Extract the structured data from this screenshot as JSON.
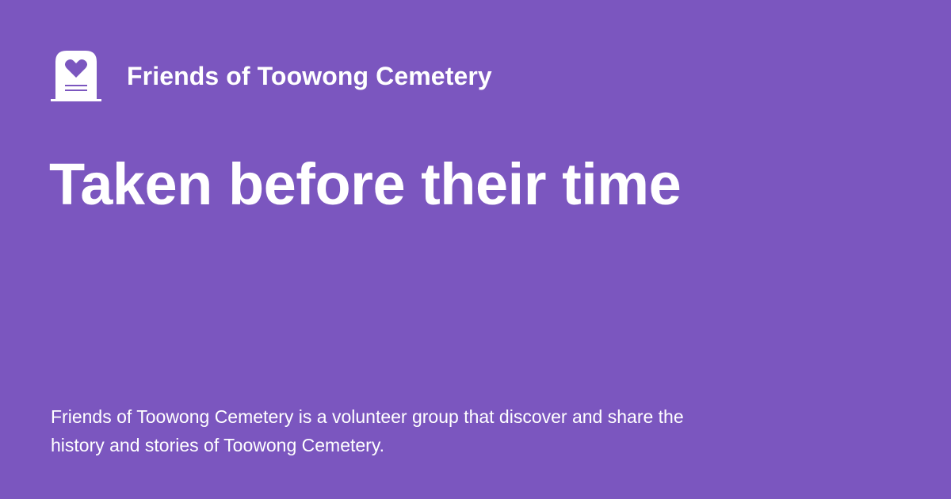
{
  "colors": {
    "background": "#7b56bf",
    "text": "#ffffff"
  },
  "brand": {
    "logo_icon": "headstone-heart-icon",
    "name": "Friends of Toowong Cemetery"
  },
  "headline": "Taken before their time",
  "description": "Friends of Toowong Cemetery is a volunteer group that discover and share the history and stories of Toowong Cemetery."
}
